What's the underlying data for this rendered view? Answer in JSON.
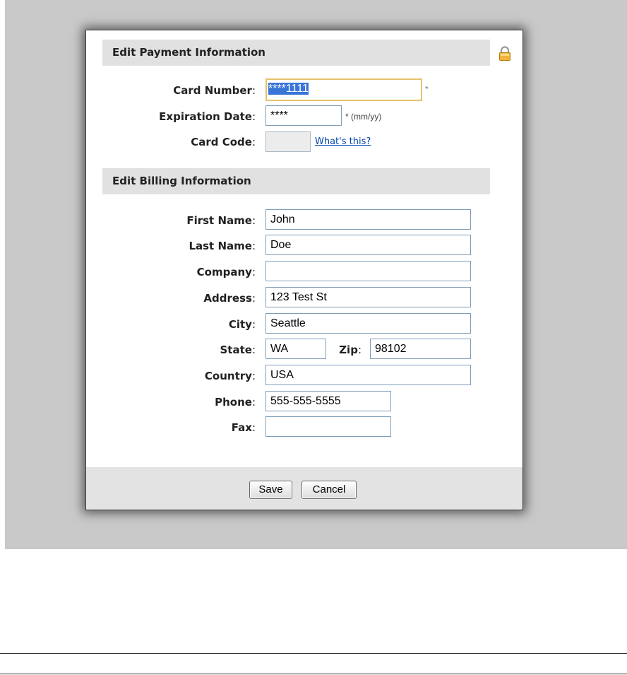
{
  "payment": {
    "header": "Edit Payment Information",
    "card_number_label": "Card Number",
    "card_number_value": "****1111",
    "card_number_required": "*",
    "expiration_label": "Expiration Date",
    "expiration_value": "****",
    "expiration_hint": "* (mm/yy)",
    "card_code_label": "Card Code",
    "card_code_value": "",
    "whats_this_link": "What's this?"
  },
  "billing": {
    "header": "Edit Billing Information",
    "first_name_label": "First Name",
    "first_name_value": "John",
    "last_name_label": "Last Name",
    "last_name_value": "Doe",
    "company_label": "Company",
    "company_value": "",
    "address_label": "Address",
    "address_value": "123 Test St",
    "city_label": "City",
    "city_value": "Seattle",
    "state_label": "State",
    "state_value": "WA",
    "zip_label": "Zip",
    "zip_value": "98102",
    "country_label": "Country",
    "country_value": "USA",
    "phone_label": "Phone",
    "phone_value": "555-555-5555",
    "fax_label": "Fax",
    "fax_value": ""
  },
  "buttons": {
    "save": "Save",
    "cancel": "Cancel"
  },
  "icons": {
    "lock": "lock-icon"
  },
  "colors": {
    "backdrop": "#c9c9c9",
    "section_header": "#e1e1e1",
    "focus_border": "#e5c36c",
    "selection": "#3875d7",
    "link": "#0645ad"
  }
}
